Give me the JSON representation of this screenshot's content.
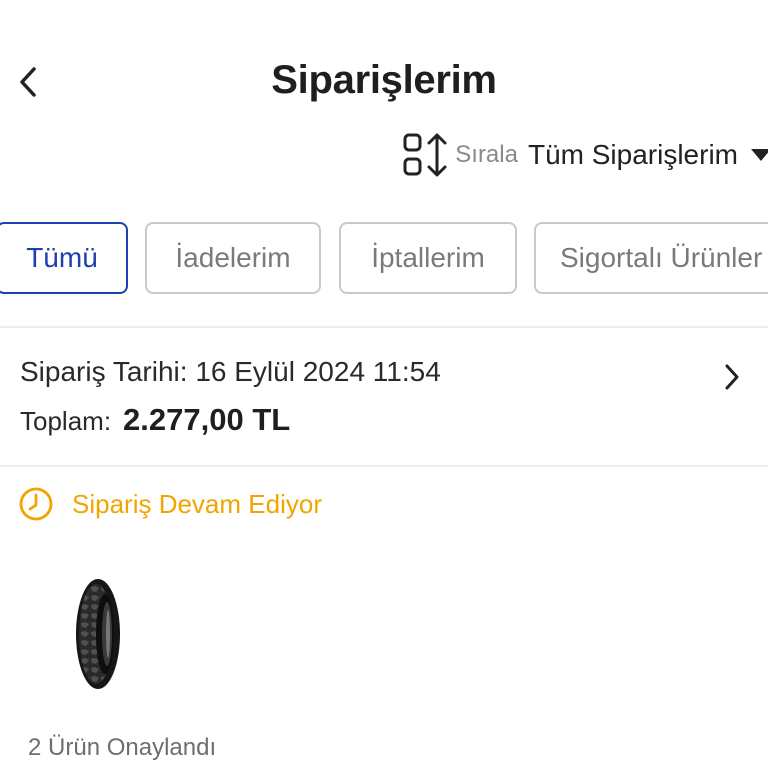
{
  "header": {
    "title": "Siparişlerim",
    "back_icon": "chevron-left-icon"
  },
  "sort": {
    "icon": "sort-icon",
    "label": "Sırala",
    "value": "Tüm Siparişlerim",
    "caret_icon": "caret-down-icon"
  },
  "tabs": [
    {
      "label": "Tümü",
      "active": true
    },
    {
      "label": "İadelerim",
      "active": false
    },
    {
      "label": "İptallerim",
      "active": false
    },
    {
      "label": "Sigortalı Ürünler",
      "active": false
    }
  ],
  "order": {
    "date_text": "Sipariş Tarihi: 16 Eylül 2024 11:54",
    "total_label": "Toplam:",
    "total_value": "2.277,00 TL",
    "chevron_icon": "chevron-right-icon",
    "status_icon": "clock-icon",
    "status_text": "Sipariş Devam Ediyor",
    "status_color": "#f0a500",
    "product_image": "tire-image",
    "approved_text": "2 Ürün Onaylandı"
  },
  "colors": {
    "accent": "#1e3fb0",
    "tab_border": "#c9c9c9",
    "divider": "#ececec",
    "status": "#f0a500"
  }
}
